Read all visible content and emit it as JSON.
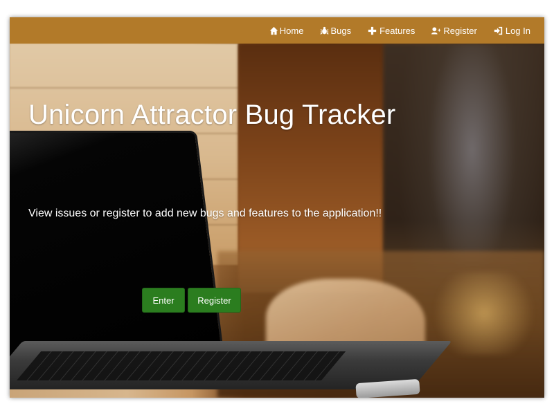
{
  "nav": {
    "items": [
      {
        "label": "Home",
        "icon": "home-icon"
      },
      {
        "label": "Bugs",
        "icon": "bug-icon"
      },
      {
        "label": "Features",
        "icon": "plus-icon"
      },
      {
        "label": "Register",
        "icon": "user-plus-icon"
      },
      {
        "label": "Log In",
        "icon": "sign-in-icon"
      }
    ]
  },
  "hero": {
    "title": "Unicorn Attractor Bug Tracker",
    "subtitle": "View issues or register to add new bugs and features to the application!!",
    "buttons": {
      "enter_label": "Enter",
      "register_label": "Register"
    }
  },
  "colors": {
    "navbar": "#b27a29",
    "button": "#2b7d1f",
    "text": "#ffffff"
  }
}
